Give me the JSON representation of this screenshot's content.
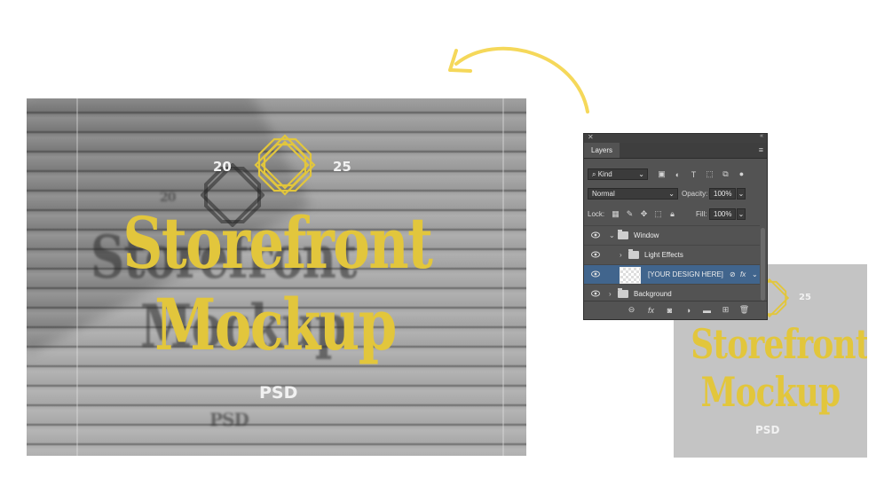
{
  "mockup": {
    "year_left": "20",
    "year_right": "25",
    "title_line1": "Storefront",
    "title_line2": "Mockup",
    "subtitle": "PSD"
  },
  "preview": {
    "year_right": "25",
    "title_line1": "Storefront",
    "title_line2": "Mockup",
    "subtitle": "PSD"
  },
  "layers_panel": {
    "tab_label": "Layers",
    "filter_kind": "Kind",
    "blend_mode": "Normal",
    "opacity_label": "Opacity:",
    "opacity_value": "100%",
    "lock_label": "Lock:",
    "fill_label": "Fill:",
    "fill_value": "100%",
    "layers": [
      {
        "name": "Window",
        "type": "group",
        "expanded": true
      },
      {
        "name": "Light Effects",
        "type": "group",
        "expanded": false
      },
      {
        "name": "[YOUR DESIGN HERE]",
        "type": "smart-object",
        "selected": true,
        "fx": "fx"
      },
      {
        "name": "Background",
        "type": "group",
        "expanded": false
      }
    ]
  },
  "colors": {
    "accent_yellow": "#e2c63c",
    "panel_bg": "#535353",
    "selected_layer": "#41658d",
    "arrow": "#f5d85a"
  }
}
